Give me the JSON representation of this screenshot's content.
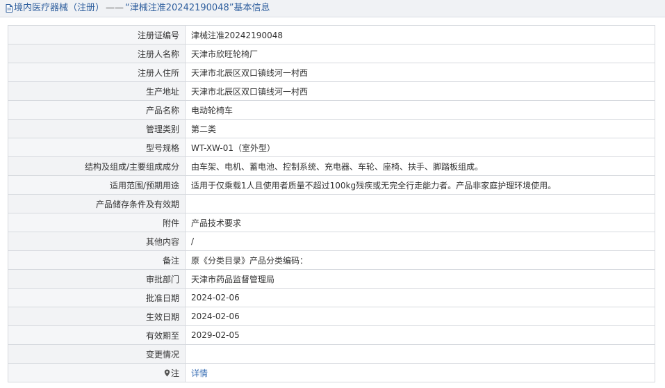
{
  "header": {
    "breadcrumb": "境内医疗器械（注册）",
    "separator": "——",
    "title": "“津械注准20242190048”基本信息"
  },
  "rows": [
    {
      "label": "注册证编号",
      "value": "津械注准20242190048"
    },
    {
      "label": "注册人名称",
      "value": "天津市欣旺轮椅厂"
    },
    {
      "label": "注册人住所",
      "value": "天津市北辰区双口镇线河一村西"
    },
    {
      "label": "生产地址",
      "value": "天津市北辰区双口镇线河一村西"
    },
    {
      "label": "产品名称",
      "value": "电动轮椅车"
    },
    {
      "label": "管理类别",
      "value": "第二类"
    },
    {
      "label": "型号规格",
      "value": "WT-XW-01（室外型）"
    },
    {
      "label": "结构及组成/主要组成成分",
      "value": "由车架、电机、蓄电池、控制系统、充电器、车轮、座椅、扶手、脚踏板组成。"
    },
    {
      "label": "适用范围/预期用途",
      "value": "适用于仅乘载1人且使用者质量不超过100kg残疾或无完全行走能力者。产品非家庭护理环境使用。"
    },
    {
      "label": "产品储存条件及有效期",
      "value": ""
    },
    {
      "label": "附件",
      "value": "产品技术要求"
    },
    {
      "label": "其他内容",
      "value": "/"
    },
    {
      "label": "备注",
      "value": "原《分类目录》产品分类编码："
    },
    {
      "label": "审批部门",
      "value": "天津市药品监督管理局"
    },
    {
      "label": "批准日期",
      "value": "2024-02-06"
    },
    {
      "label": "生效日期",
      "value": "2024-02-06"
    },
    {
      "label": "有效期至",
      "value": "2029-02-05"
    },
    {
      "label": "变更情况",
      "value": ""
    }
  ],
  "note_row": {
    "label": "注",
    "link": "详情",
    "icon": "location-pin-icon"
  },
  "colors": {
    "link": "#3a6fb5",
    "title": "#2f5f9e",
    "border": "#d6d9de",
    "label_bg": "#f5f6f8"
  }
}
